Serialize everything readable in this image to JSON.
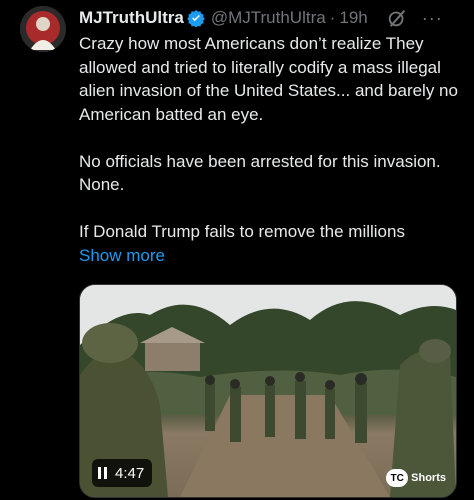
{
  "tweet": {
    "display_name": "MJTruthUltra",
    "handle": "@MJTruthUltra",
    "separator": "·",
    "time": "19h",
    "paragraphs": [
      "Crazy how most Americans don’t realize They allowed and tried to literally codify a mass illegal alien invasion of the United States... and barely no American batted an eye.",
      "No officials have been arrested for this invasion. None.",
      "If Donald Trump fails to remove the millions"
    ],
    "show_more_label": "Show more",
    "more_menu_glyph": "···"
  },
  "media": {
    "duration": "4:47",
    "watermark_text": "Shorts",
    "watermark_logo_text": "TC"
  },
  "colors": {
    "background": "#000000",
    "text": "#e7e9ea",
    "secondary": "#71767b",
    "link": "#1d9bf0",
    "verified": "#1d9bf0"
  }
}
